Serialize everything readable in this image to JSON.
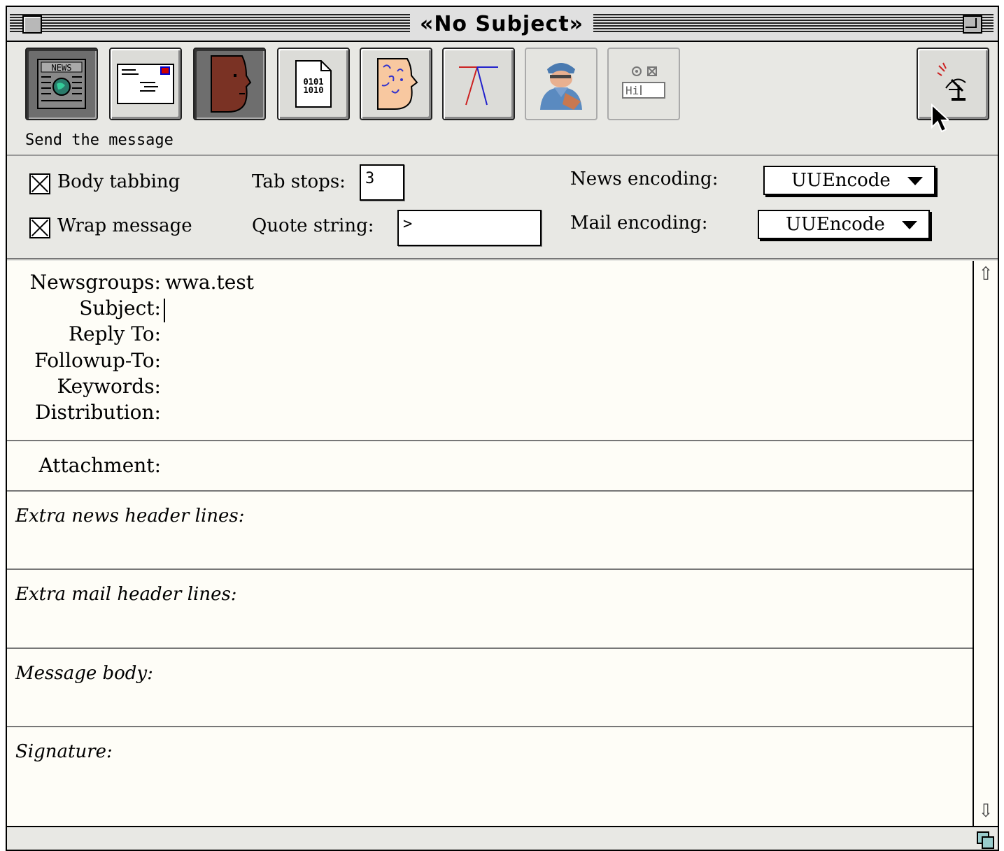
{
  "window": {
    "title": "«No Subject»"
  },
  "toolbar": {
    "buttons": [
      {
        "name": "news",
        "icon": "news-icon"
      },
      {
        "name": "mail",
        "icon": "envelope-icon"
      },
      {
        "name": "face",
        "icon": "face-icon"
      },
      {
        "name": "binary",
        "icon": "binary-file-icon",
        "glyph": "0101\n1010"
      },
      {
        "name": "pattern-face",
        "icon": "pattern-face-icon"
      },
      {
        "name": "redblue",
        "icon": "branch-icon"
      },
      {
        "name": "spy",
        "icon": "spy-icon"
      },
      {
        "name": "hi",
        "icon": "hi-icon",
        "glyph": "Hi"
      },
      {
        "name": "send",
        "icon": "satellite-send-icon"
      }
    ],
    "status": "Send the message"
  },
  "options": {
    "body_tabbing": {
      "label": "Body tabbing",
      "checked": true
    },
    "wrap_message": {
      "label": "Wrap message",
      "checked": true
    },
    "tab_stops": {
      "label": "Tab stops:",
      "value": "3"
    },
    "quote_string": {
      "label": "Quote string:",
      "value": ">"
    },
    "news_encoding": {
      "label": "News encoding:",
      "value": "UUEncode"
    },
    "mail_encoding": {
      "label": "Mail encoding:",
      "value": "UUEncode"
    }
  },
  "headers": {
    "newsgroups": {
      "label": "Newsgroups:",
      "value": "wwa.test"
    },
    "subject": {
      "label": "Subject:",
      "value": ""
    },
    "reply_to": {
      "label": "Reply To:",
      "value": ""
    },
    "followup_to": {
      "label": "Followup-To:",
      "value": ""
    },
    "keywords": {
      "label": "Keywords:",
      "value": ""
    },
    "distribution": {
      "label": "Distribution:",
      "value": ""
    }
  },
  "attachment": {
    "label": "Attachment:"
  },
  "sections": {
    "extra_news": "Extra news header lines:",
    "extra_mail": "Extra mail header lines:",
    "message_body": "Message body:",
    "signature": "Signature:"
  }
}
